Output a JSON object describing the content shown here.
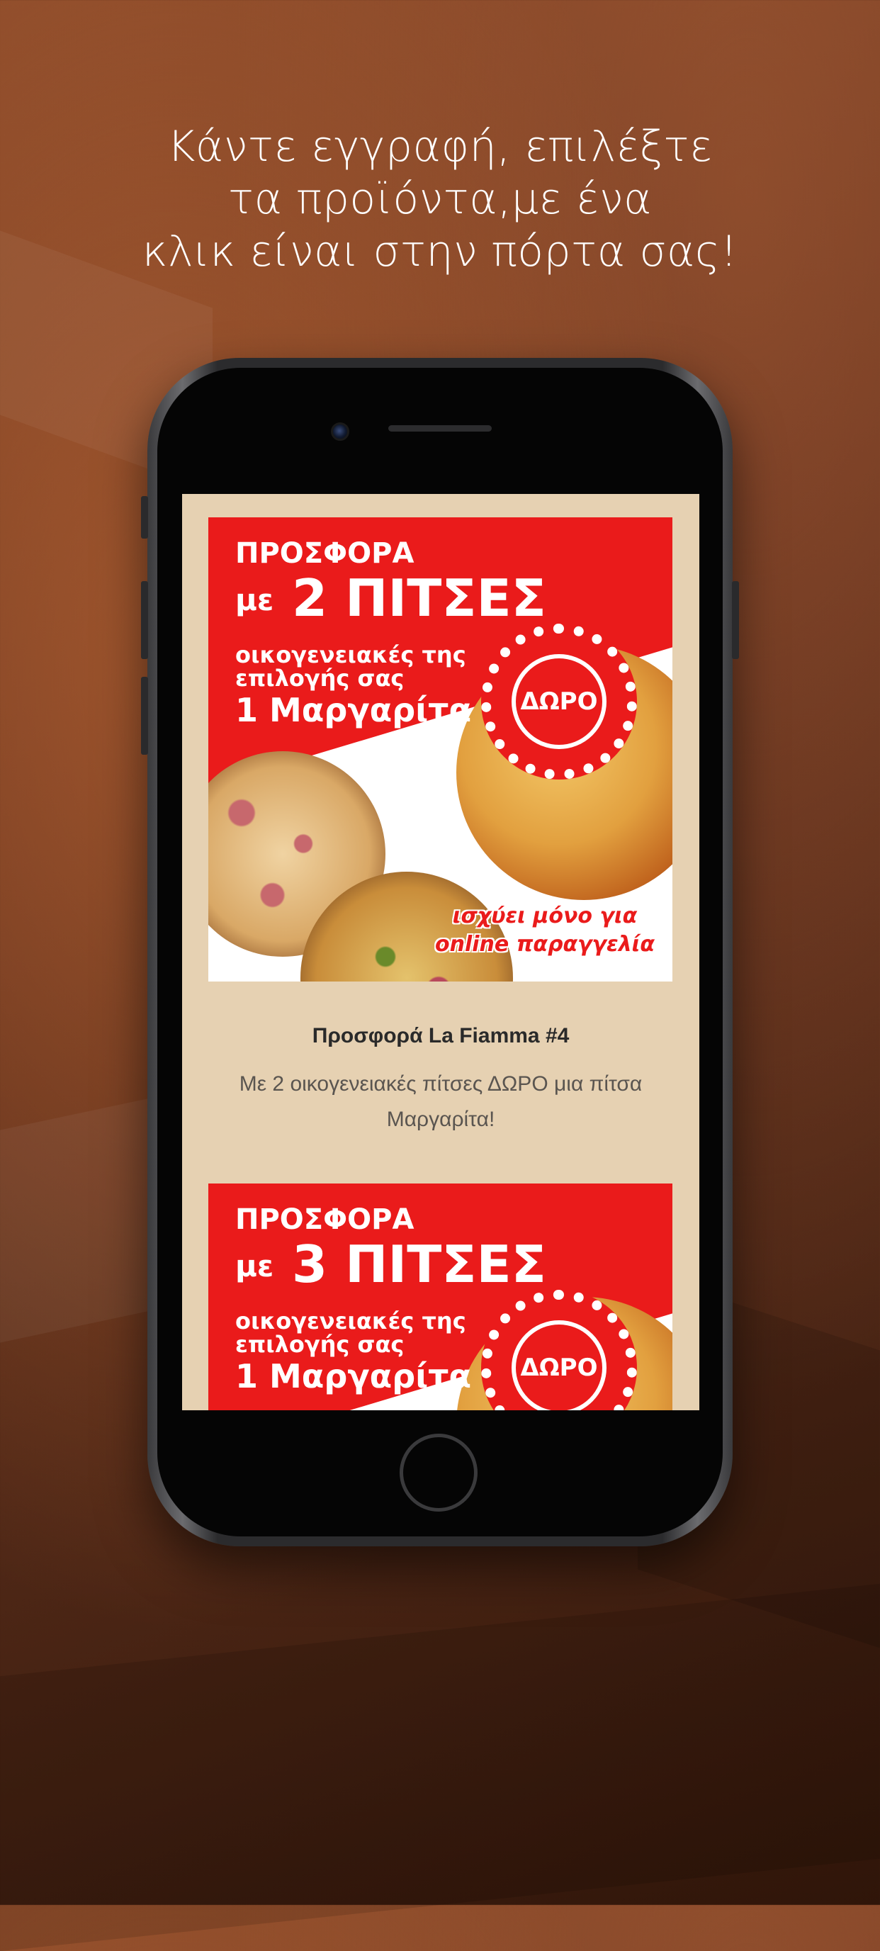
{
  "headline": {
    "line1": "Κάντε εγγραφή, επιλέξτε",
    "line2": "τα προϊόντα,με ένα",
    "line3": "κλικ είναι στην πόρτα σας!"
  },
  "offers": [
    {
      "image": {
        "line1": "ΠΡΟΣΦΟΡΑ",
        "line2_prefix": "με",
        "line2_main": "2 ΠΙΤΣΕΣ",
        "line3": "οικογενειακές της",
        "line4": "επιλογής σας",
        "line5": "1 Μαργαρίτα",
        "badge": "ΔΩΡΟ",
        "note_line1": "ισχύει μόνο για",
        "note_line2": "online παραγγελία"
      },
      "title": "Προσφορά La Fiamma #4",
      "description": "Με 2 οικογενειακές πίτσες ΔΩΡΟ μια πίτσα Μαργαρίτα!"
    },
    {
      "image": {
        "line1": "ΠΡΟΣΦΟΡΑ",
        "line2_prefix": "με",
        "line2_main": "3 ΠΙΤΣΕΣ",
        "line3": "οικογενειακές της",
        "line4": "επιλογής σας",
        "line5": "1 Μαργαρίτα",
        "badge": "ΔΩΡΟ"
      }
    }
  ],
  "colors": {
    "promo_red": "#ea1b1b",
    "screen_bg": "#e6d1b2"
  }
}
